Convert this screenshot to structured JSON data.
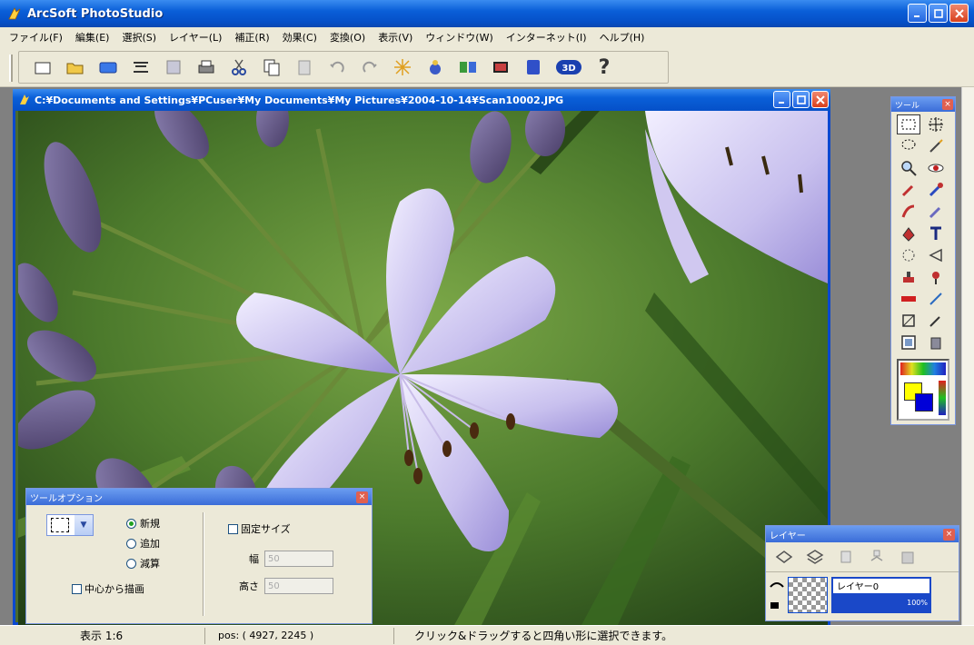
{
  "app": {
    "title": "ArcSoft PhotoStudio"
  },
  "menu": [
    "ファイル(F)",
    "編集(E)",
    "選択(S)",
    "レイヤー(L)",
    "補正(R)",
    "効果(C)",
    "変換(O)",
    "表示(V)",
    "ウィンドウ(W)",
    "インターネット(I)",
    "ヘルプ(H)"
  ],
  "toolbar": {
    "icons": [
      "new-icon",
      "open-icon",
      "acquire-icon",
      "scan-icon",
      "save-icon",
      "print-icon",
      "cut-icon",
      "copy-icon",
      "paste-icon",
      "undo-icon",
      "redo-icon",
      "magic-icon",
      "wizard-icon",
      "compare-icon",
      "slideshow-icon",
      "album-icon",
      "3d-icon",
      "help-icon"
    ],
    "labels": {
      "3d": "3D",
      "help": "?"
    }
  },
  "document": {
    "title": "C:¥Documents and Settings¥PCuser¥My Documents¥My Pictures¥2004-10-14¥Scan10002.JPG"
  },
  "tool_palette": {
    "title": "ツール",
    "close": "×"
  },
  "tool_options": {
    "title": "ツールオプション",
    "close": "×",
    "radios": [
      {
        "label": "新規",
        "selected": true
      },
      {
        "label": "追加",
        "selected": false
      },
      {
        "label": "減算",
        "selected": false
      }
    ],
    "center_check": "中心から描画",
    "fixed_size_check": "固定サイズ",
    "width_label": "幅",
    "width_value": "50",
    "height_label": "高さ",
    "height_value": "50"
  },
  "layers": {
    "title": "レイヤー",
    "close": "×",
    "layer_name": "レイヤー0",
    "opacity": "100%"
  },
  "status": {
    "zoom": "表示 1:6",
    "pos": "pos: ( 4927, 2245 )",
    "hint": "クリック&ドラッグすると四角い形に選択できます。"
  },
  "colors": {
    "titlebar": "#0a5fd8",
    "face": "#ece9d8",
    "close": "#d8401c"
  }
}
